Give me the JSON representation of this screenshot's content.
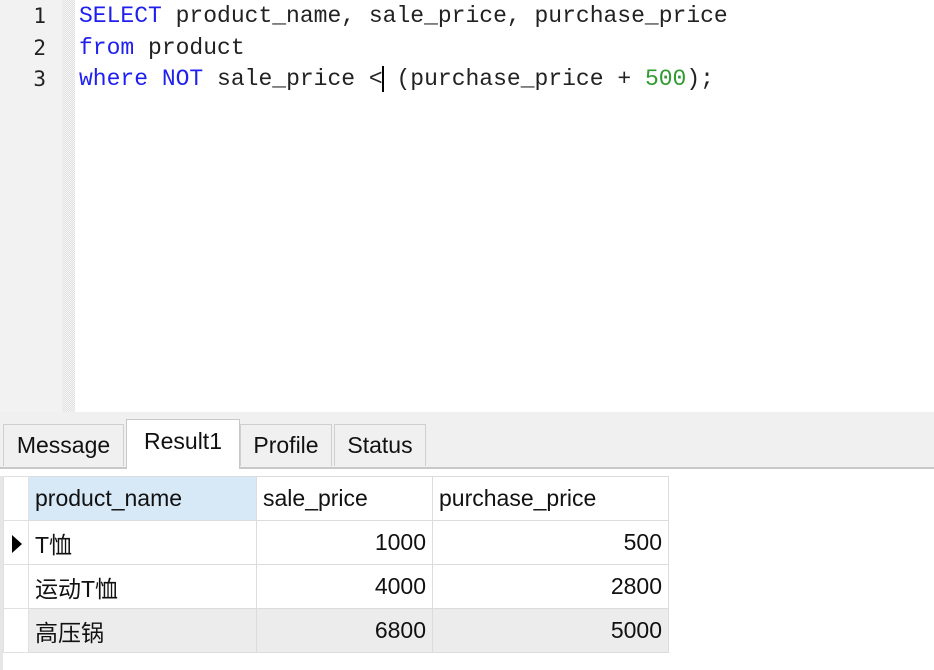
{
  "editor": {
    "lines": [
      {
        "number": "1",
        "tokens": [
          {
            "text": "SELECT",
            "kind": "keyword"
          },
          {
            "text": " product_name, sale_price, purchase_price",
            "kind": "plain"
          }
        ]
      },
      {
        "number": "2",
        "tokens": [
          {
            "text": "from",
            "kind": "keyword"
          },
          {
            "text": " product",
            "kind": "plain"
          }
        ]
      },
      {
        "number": "3",
        "tokens": [
          {
            "text": "where",
            "kind": "keyword"
          },
          {
            "text": " ",
            "kind": "plain"
          },
          {
            "text": "NOT",
            "kind": "keyword"
          },
          {
            "text": " sale_price <",
            "kind": "plain"
          },
          {
            "text": " (purchase_price + ",
            "kind": "plain"
          },
          {
            "text": "500",
            "kind": "number"
          },
          {
            "text": ");",
            "kind": "plain"
          }
        ]
      }
    ],
    "colors": {
      "keyword": "#1f1ff0",
      "number": "#2f9a2f",
      "plain": "#222222"
    }
  },
  "tabs": [
    {
      "label": "Message",
      "active": false
    },
    {
      "label": "Result1",
      "active": true
    },
    {
      "label": "Profile",
      "active": false
    },
    {
      "label": "Status",
      "active": false
    }
  ],
  "result": {
    "columns": [
      "product_name",
      "sale_price",
      "purchase_price"
    ],
    "selected_column": "product_name",
    "rows": [
      {
        "product_name": "T恤",
        "sale_price": "1000",
        "purchase_price": "500",
        "current": true
      },
      {
        "product_name": "运动T恤",
        "sale_price": "4000",
        "purchase_price": "2800",
        "current": false
      },
      {
        "product_name": "高压锅",
        "sale_price": "6800",
        "purchase_price": "5000",
        "current": false
      }
    ],
    "current_row_icon": "row-pointer-icon",
    "colors": {
      "header_selected": "#d7e8f7",
      "alt_row": "#ececec"
    }
  }
}
